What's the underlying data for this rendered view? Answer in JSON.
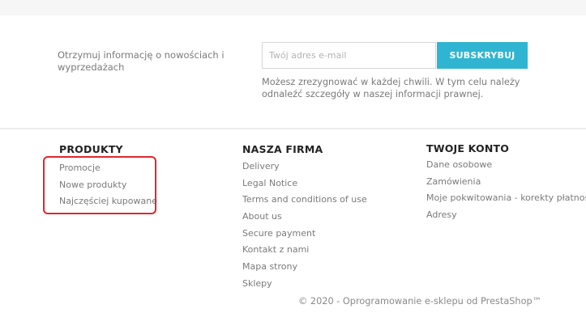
{
  "newsletter": {
    "text": "Otrzymuj informację o nowościach i wyprzedażach",
    "email_placeholder": "Twój adres e-mail",
    "email_value": "",
    "subscribe_label": "SUBSKRYBUJ",
    "note": "Możesz zrezygnować w każdej chwili. W tym celu należy odnaleźć szczegóły w naszej informacji prawnej."
  },
  "footer": {
    "products": {
      "title": "PRODUKTY",
      "items": [
        "Promocje",
        "Nowe produkty",
        "Najczęściej kupowane"
      ]
    },
    "company": {
      "title": "NASZA FIRMA",
      "items": [
        "Delivery",
        "Legal Notice",
        "Terms and conditions of use",
        "About us",
        "Secure payment",
        "Kontakt z nami",
        "Mapa strony",
        "Sklepy"
      ]
    },
    "account": {
      "title": "TWOJE KONTO",
      "items": [
        "Dane osobowe",
        "Zamówienia",
        "Moje pokwitowania - korekty płatności",
        "Adresy"
      ]
    },
    "copyright": "© 2020 - Oprogramowanie e-sklepu od PrestaShop™"
  },
  "colors": {
    "accent": "#2fb5d2",
    "highlight_border": "#e0272d",
    "heading": "#232323",
    "text": "#7a7a7a"
  }
}
